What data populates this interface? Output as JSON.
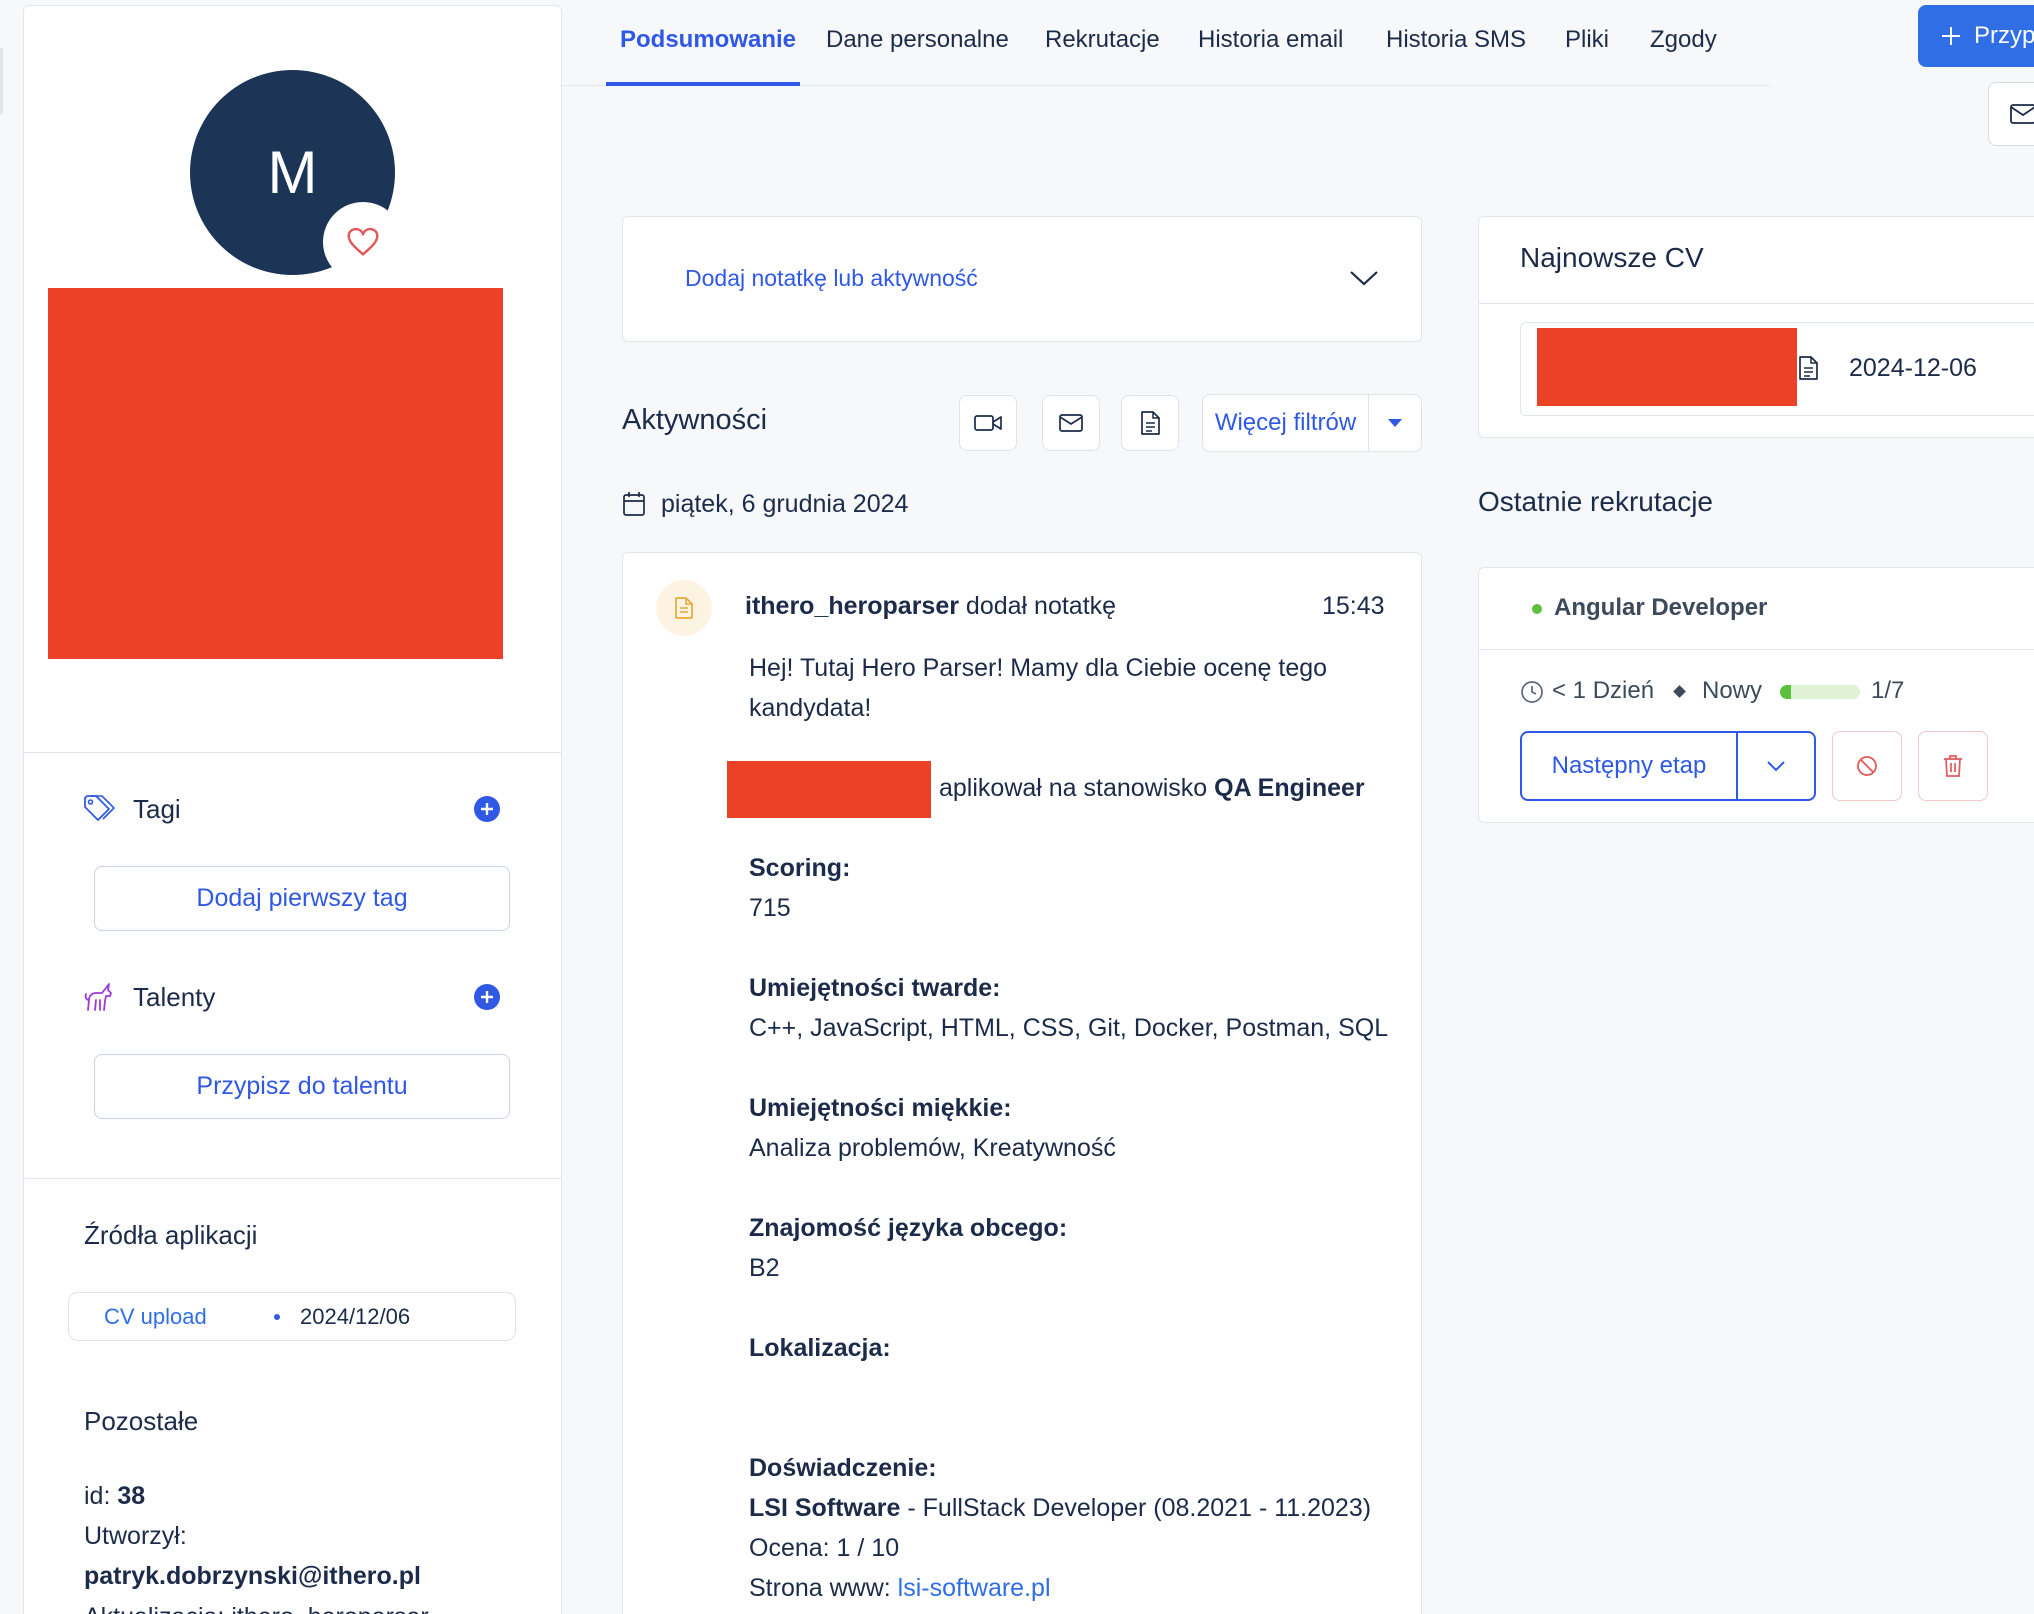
{
  "profile": {
    "avatar_initial": "M"
  },
  "tags": {
    "title": "Tagi",
    "add_button": "Dodaj pierwszy tag"
  },
  "talents": {
    "title": "Talenty",
    "assign_button": "Przypisz do talentu"
  },
  "sources": {
    "title": "Źródła aplikacji",
    "item_name": "CV upload",
    "item_date": "2024/12/06"
  },
  "other": {
    "title": "Pozostałe",
    "id_label": "id:",
    "id_value": "38",
    "created_label": "Utworzył:",
    "created_value": "patryk.dobrzynski@ithero.pl",
    "updated_label": "Aktualizacja:",
    "updated_value": "ithero_heroparser"
  },
  "tabs": [
    {
      "label": "Podsumowanie",
      "active": true
    },
    {
      "label": "Dane personalne"
    },
    {
      "label": "Rekrutacje"
    },
    {
      "label": "Historia email"
    },
    {
      "label": "Historia SMS"
    },
    {
      "label": "Pliki"
    },
    {
      "label": "Zgody"
    }
  ],
  "header": {
    "primary_button": "Przyp"
  },
  "note_box": {
    "placeholder": "Dodaj notatkę lub aktywność"
  },
  "activities": {
    "title": "Aktywności",
    "more_filters": "Więcej filtrów",
    "date": "piątek, 6 grudnia 2024",
    "entry": {
      "author": "ithero_heroparser",
      "action": "dodał notatkę",
      "time": "15:43",
      "intro": "Hej! Tutaj Hero Parser! Mamy dla Ciebie ocenę tego kandydata!",
      "applied_text": "aplikował na stanowisko",
      "position": "QA Engineer",
      "scoring_label": "Scoring:",
      "scoring_value": "715",
      "hard_skills_label": "Umiejętności twarde:",
      "hard_skills_value": "C++, JavaScript, HTML, CSS, Git, Docker, Postman, SQL",
      "soft_skills_label": "Umiejętności miękkie:",
      "soft_skills_value": "Analiza problemów, Kreatywność",
      "language_label": "Znajomość języka obcego:",
      "language_value": "B2",
      "location_label": "Lokalizacja:",
      "experience_label": "Doświadczenie:",
      "experience_company": "LSI Software",
      "experience_role": "- FullStack Developer (08.2021 - 11.2023)",
      "rating": "Ocena: 1 / 10",
      "website_label": "Strona www:",
      "website_value": "lsi-software.pl"
    }
  },
  "latest_cv": {
    "title": "Najnowsze CV",
    "date": "2024-12-06"
  },
  "recent_recruitments": {
    "title": "Ostatnie rekrutacje",
    "item": {
      "name": "Angular Developer",
      "duration": "< 1 Dzień",
      "status": "Nowy",
      "progress_fraction": 0.14,
      "progress_label": "1/7",
      "next_stage_button": "Następny etap"
    }
  },
  "colors": {
    "accent": "#2f59e4",
    "avatar": "#1c3556",
    "redaction": "#eb4126",
    "success": "#5cc040",
    "danger": "#e05a5a",
    "note_icon": "#e6a93a"
  }
}
